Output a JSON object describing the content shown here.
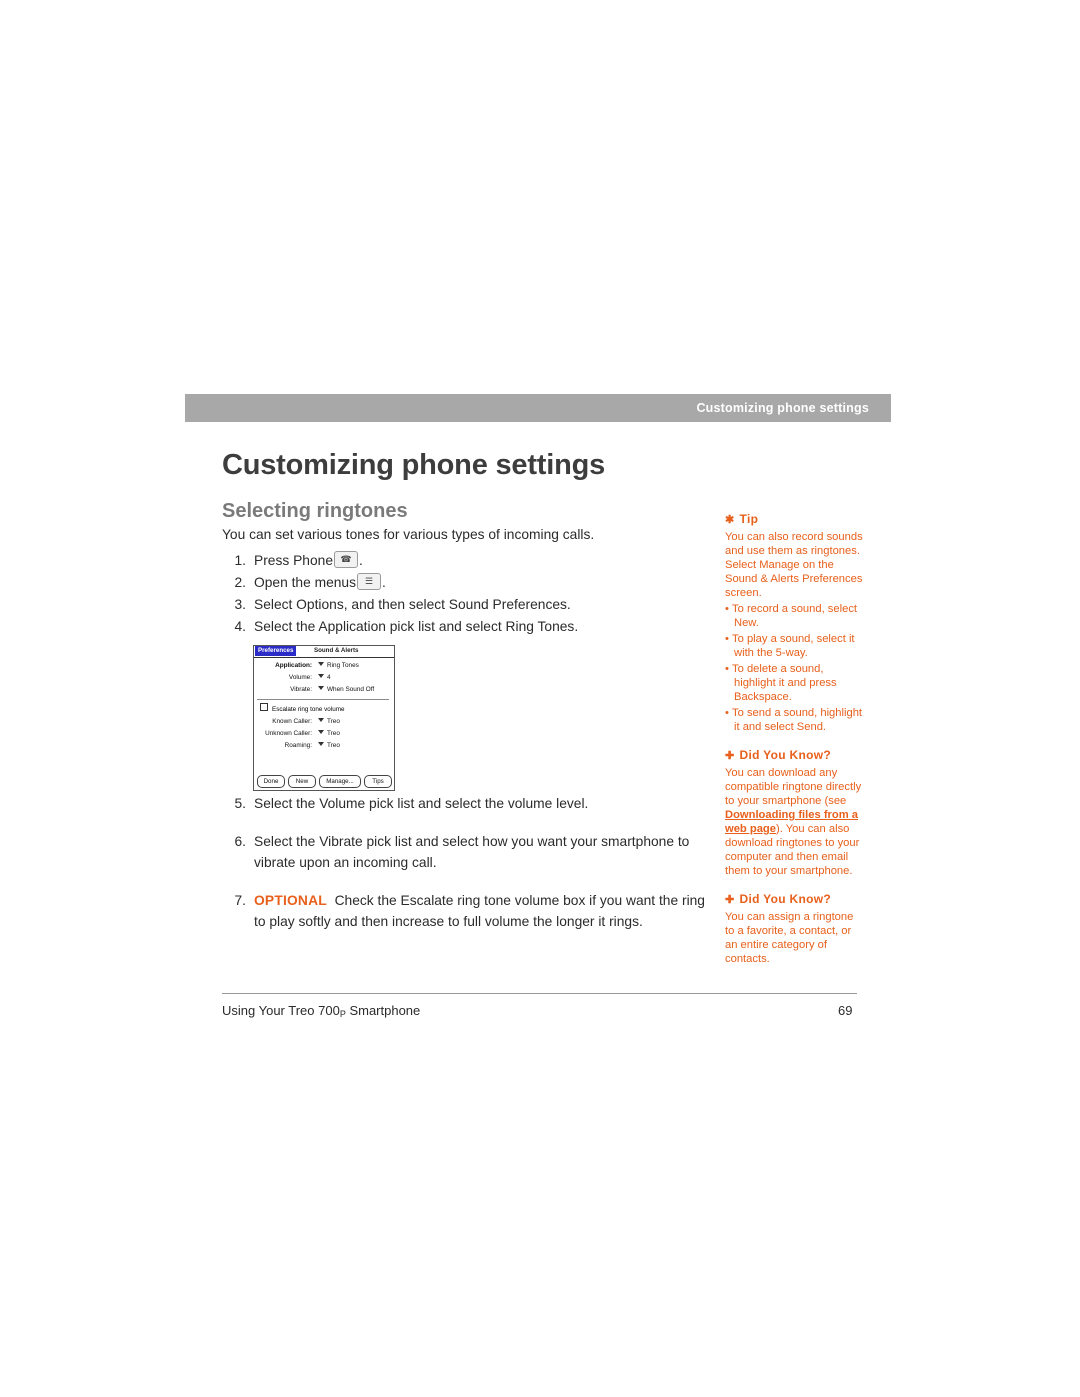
{
  "header": {
    "running_head": "Customizing phone settings"
  },
  "titles": {
    "page_title": "Customizing phone settings",
    "section_title": "Selecting ringtones"
  },
  "intro": "You can set various tones for various types of incoming calls.",
  "steps": [
    {
      "num": "1.",
      "text_before": "Press Phone",
      "icon": "phone-key-icon",
      "text_after": "."
    },
    {
      "num": "2.",
      "text_before": "Open the menus",
      "icon": "menu-key-icon",
      "text_after": "."
    },
    {
      "num": "3.",
      "text": "Select Options, and then select Sound Preferences."
    },
    {
      "num": "4.",
      "text": "Select the Application pick list and select Ring Tones."
    }
  ],
  "steps2": [
    {
      "num": "5.",
      "text": "Select the Volume pick list and select the volume level."
    },
    {
      "num": "6.",
      "text": "Select the Vibrate pick list and select how you want your smartphone to vibrate upon an incoming call."
    },
    {
      "num": "7.",
      "label": "OPTIONAL",
      "text": "Check the Escalate ring tone volume box if you want the ring to play softly and then increase to full volume the longer it rings."
    }
  ],
  "device": {
    "tab_label": "Preferences",
    "title": "Sound & Alerts",
    "rows": [
      {
        "label": "Application:",
        "value": "Ring Tones"
      },
      {
        "label": "Volume:",
        "value": "4"
      },
      {
        "label": "Vibrate:",
        "value": "When Sound Off"
      }
    ],
    "checkbox_label": "Escalate ring tone volume",
    "rows2": [
      {
        "label": "Known Caller:",
        "value": "Treo"
      },
      {
        "label": "Unknown Caller:",
        "value": "Treo"
      },
      {
        "label": "Roaming:",
        "value": "Treo"
      }
    ],
    "buttons": [
      "Done",
      "New",
      "Manage...",
      "Tips"
    ]
  },
  "sidebar": [
    {
      "head": "Tip",
      "icon": "asterisk-icon",
      "body": "You can also record sounds and use them as ringtones. Select Manage on the Sound & Alerts Preferences screen.",
      "bullets": [
        "To record a sound, select New.",
        "To play a sound, select it with the 5-way.",
        "To delete a sound, highlight it and press Backspace.",
        "To send a sound, highlight it and select Send."
      ]
    },
    {
      "head": "Did You Know?",
      "icon": "plus-icon",
      "body_1": "You can download any compatible ringtone directly to your smartphone (see ",
      "link": "Downloading files from a web page",
      "body_2": "). You can also download ringtones to your computer and then email them to your smartphone."
    },
    {
      "head": "Did You Know?",
      "icon": "plus-icon",
      "body": "You can assign a ringtone to a favorite, a contact, or an entire category of contacts."
    }
  ],
  "footer": {
    "left_before": "Using Your Treo 700",
    "left_sub": "P",
    "left_after": " Smartphone",
    "page_number": "69"
  },
  "colors": {
    "accent": "#e8601c",
    "header_bar": "#a8a8a8",
    "title": "#3d3d3d",
    "section": "#7a7a7a"
  }
}
